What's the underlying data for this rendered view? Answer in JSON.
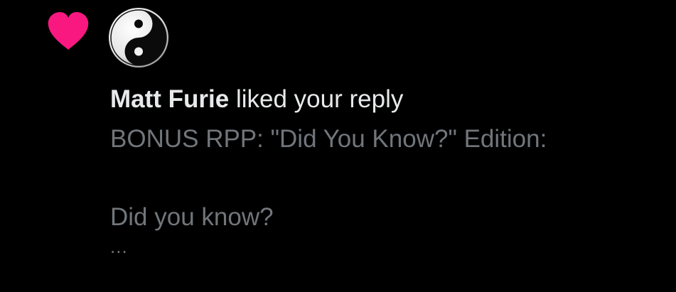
{
  "notification": {
    "icon": "heart-icon",
    "icon_color": "#f91880",
    "avatar": "yin-yang-avatar",
    "user_name": "Matt Furie",
    "action_text": "liked your reply",
    "preview_line_1": "BONUS RPP: \"Did You Know?\" Edition:",
    "preview_line_2": "Did you know?",
    "preview_ellipsis": "..."
  },
  "colors": {
    "background": "#000000",
    "primary_text": "#e7e9ea",
    "secondary_text": "#71767b",
    "like": "#f91880"
  }
}
